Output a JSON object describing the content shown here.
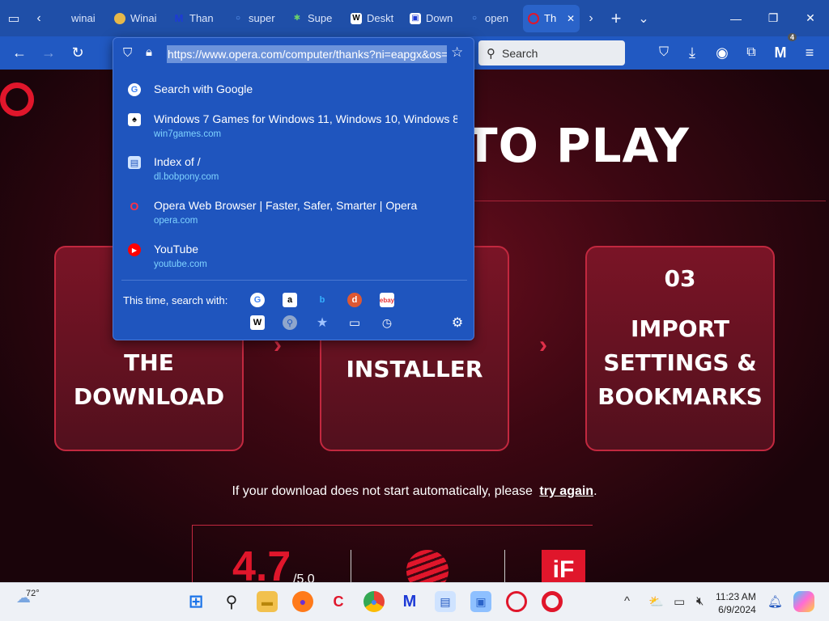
{
  "tabs": [
    {
      "title": "winai",
      "fav_color": "#ffffff",
      "fav_char": ""
    },
    {
      "title": "Winai",
      "fav_color": "#e6b84a",
      "fav_char": "●"
    },
    {
      "title": "Than",
      "fav_color": "#1d3ad6",
      "fav_char": "M"
    },
    {
      "title": "super",
      "fav_color": "#2a7cf2",
      "fav_char": "○"
    },
    {
      "title": "Supe",
      "fav_color": "#2f9a3c",
      "fav_char": "✱"
    },
    {
      "title": "Deskt",
      "fav_color": "#ffffff",
      "fav_char": "W"
    },
    {
      "title": "Down",
      "fav_color": "#ffffff",
      "fav_char": "▣"
    },
    {
      "title": "open",
      "fav_color": "#2a7cf2",
      "fav_char": "○"
    },
    {
      "title": "Th",
      "fav_color": "#e0162b",
      "fav_char": "O"
    }
  ],
  "nav": {
    "search_placeholder": "Search",
    "extensions_badge": "4"
  },
  "urlbar": {
    "url": "https://www.opera.com/computer/thanks?ni=eapgx&os="
  },
  "suggestions": [
    {
      "title": "Search with Google",
      "url": "",
      "icon": "google-icon",
      "icon_color": "#4285f4",
      "icon_char": "G"
    },
    {
      "title": "Windows 7 Games for Windows 11, Windows 10, Windows 8",
      "url": "win7games.com",
      "icon": "cards-icon",
      "icon_color": "#ffffff",
      "icon_char": "♠"
    },
    {
      "title": "Index of /",
      "url": "dl.bobpony.com",
      "icon": "folder-icon",
      "icon_color": "#cfe3ff",
      "icon_char": "▤"
    },
    {
      "title": "Opera Web Browser | Faster, Safer, Smarter | Opera",
      "url": "opera.com",
      "icon": "opera-icon",
      "icon_color": "#e0162b",
      "icon_char": "O"
    },
    {
      "title": "YouTube",
      "url": "youtube.com",
      "icon": "youtube-icon",
      "icon_color": "#ff0000",
      "icon_char": "▶"
    }
  ],
  "engines": {
    "label": "This time, search with:"
  },
  "page": {
    "hero": "TO PLAY",
    "card1": "CO\nTHE\nDOWNLOAD",
    "card2": "INSTALLER",
    "card3_num": "03",
    "card3": "IMPORT\nSETTINGS &\nBOOKMARKS",
    "retry_text": "If your download does not start automatically, please",
    "retry_link": "try again",
    "retry_end": ".",
    "rating": "4.7",
    "rating_sub": "/5.0",
    "if_logo": "iF"
  },
  "taskbar": {
    "temp": "72°",
    "time": "11:23 AM",
    "date": "6/9/2024"
  }
}
